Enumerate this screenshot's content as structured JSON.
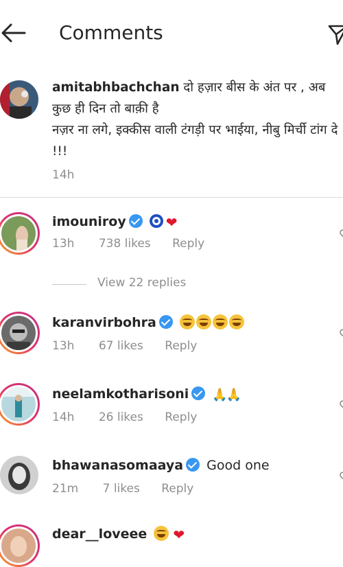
{
  "header": {
    "title": "Comments"
  },
  "caption": {
    "username": "amitabhbachchan",
    "text": " दो हज़ार बीस के अंत पर , अब कुछ ही दिन तो बाक़ी है",
    "text2": "नज़र ना लगे, इक्कीस वाली टंगड़ी पर भाईया, नीबु मिर्ची टांग दे !!!",
    "time": "14h"
  },
  "comments": [
    {
      "username": "imouniroy",
      "time": "13h",
      "likes": "738 likes",
      "reply": "Reply",
      "view_replies": "View 22 replies"
    },
    {
      "username": "karanvirbohra",
      "time": "13h",
      "likes": "67 likes",
      "reply": "Reply"
    },
    {
      "username": "neelamkotharisoni",
      "time": "14h",
      "likes": "26 likes",
      "reply": "Reply"
    },
    {
      "username": "bhawanasomaaya",
      "text": "Good one",
      "time": "21m",
      "likes": "7 likes",
      "reply": "Reply"
    },
    {
      "username": "dear__loveee"
    }
  ]
}
